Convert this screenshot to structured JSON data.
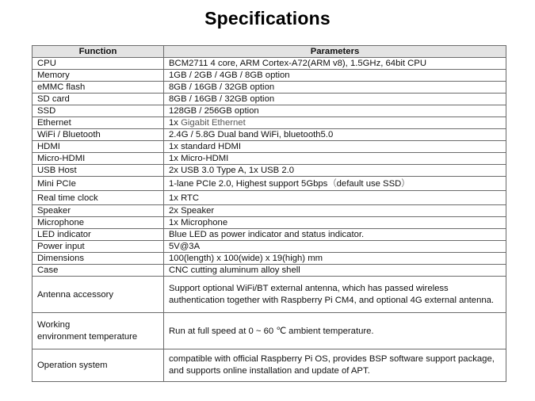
{
  "title": "Specifications",
  "table": {
    "headers": {
      "function": "Function",
      "parameters": "Parameters"
    },
    "rows": [
      {
        "function": "CPU",
        "parameters": "BCM2711 4 core, ARM Cortex-A72(ARM v8), 1.5GHz, 64bit CPU"
      },
      {
        "function": "Memory",
        "parameters": "1GB / 2GB / 4GB / 8GB option"
      },
      {
        "function": "eMMC flash",
        "parameters": "8GB / 16GB / 32GB option"
      },
      {
        "function": "SD card",
        "parameters": "8GB / 16GB / 32GB option"
      },
      {
        "function": "SSD",
        "parameters": "128GB / 256GB option"
      },
      {
        "function": "Ethernet",
        "parameters_prefix": "1x ",
        "parameters_highlight": "Gigabit Ethernet"
      },
      {
        "function": "WiFi / Bluetooth",
        "parameters": "2.4G / 5.8G Dual band WiFi, bluetooth5.0"
      },
      {
        "function": "HDMI",
        "parameters": "1x standard HDMI"
      },
      {
        "function": "Micro-HDMI",
        "parameters": "1x Micro-HDMI"
      },
      {
        "function": "USB Host",
        "parameters": "2x USB 3.0 Type A, 1x USB 2.0"
      },
      {
        "function": "Mini PCIe",
        "parameters_main": "1-lane PCIe 2.0, Highest support 5Gbps",
        "parameters_open": "（",
        "parameters_note": "default use SSD",
        "parameters_close": "）"
      },
      {
        "function": "Real time clock",
        "parameters": "1x RTC"
      },
      {
        "function": "Speaker",
        "parameters": "2x Speaker"
      },
      {
        "function": "Microphone",
        "parameters": "1x Microphone"
      },
      {
        "function": "LED indicator",
        "parameters": "Blue LED as power indicator and status indicator."
      },
      {
        "function": "Power input",
        "parameters": "5V@3A"
      },
      {
        "function": "Dimensions",
        "parameters": "100(length) x 100(wide) x 19(high) mm"
      },
      {
        "function": "Case",
        "parameters": "CNC cutting aluminum alloy shell"
      },
      {
        "function": "Antenna accessory",
        "parameters": "Support optional WiFi/BT external antenna, which has passed wireless authentication together with Raspberry Pi CM4, and optional 4G external antenna."
      },
      {
        "function_line1": "Working",
        "function_line2": "environment temperature",
        "parameters": "Run at full speed at 0 ~ 60 ℃ ambient temperature."
      },
      {
        "function": "Operation system",
        "parameters": "compatible with official Raspberry Pi OS, provides BSP software support package, and supports online installation and update of APT."
      }
    ]
  }
}
